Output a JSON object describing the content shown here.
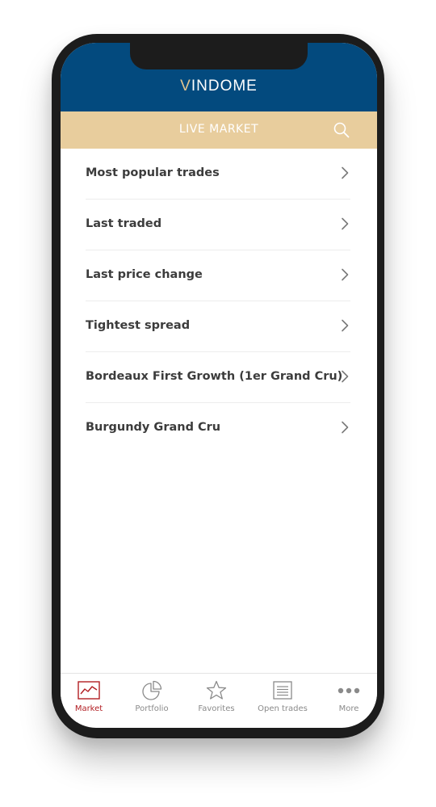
{
  "header": {
    "brand_initial": "V",
    "brand_rest": "INDOME"
  },
  "subheader": {
    "title": "LIVE MARKET",
    "search_icon": "search-icon"
  },
  "list": {
    "items": [
      {
        "label": "Most popular trades"
      },
      {
        "label": "Last traded"
      },
      {
        "label": "Last price change"
      },
      {
        "label": "Tightest spread"
      },
      {
        "label": "Bordeaux First Growth (1er Grand Cru)"
      },
      {
        "label": "Burgundy Grand Cru"
      }
    ]
  },
  "tabbar": {
    "tabs": [
      {
        "label": "Market",
        "icon": "market-chart-icon",
        "active": true
      },
      {
        "label": "Portfolio",
        "icon": "pie-chart-icon",
        "active": false
      },
      {
        "label": "Favorites",
        "icon": "star-icon",
        "active": false
      },
      {
        "label": "Open trades",
        "icon": "document-icon",
        "active": false
      },
      {
        "label": "More",
        "icon": "more-dots-icon",
        "active": false
      }
    ]
  },
  "colors": {
    "header_blue": "#034a7e",
    "subheader_gold": "#e8cd9d",
    "brand_accent": "#e3c58f",
    "active_red": "#b21e23",
    "inactive_gray": "#8a8a8a"
  }
}
